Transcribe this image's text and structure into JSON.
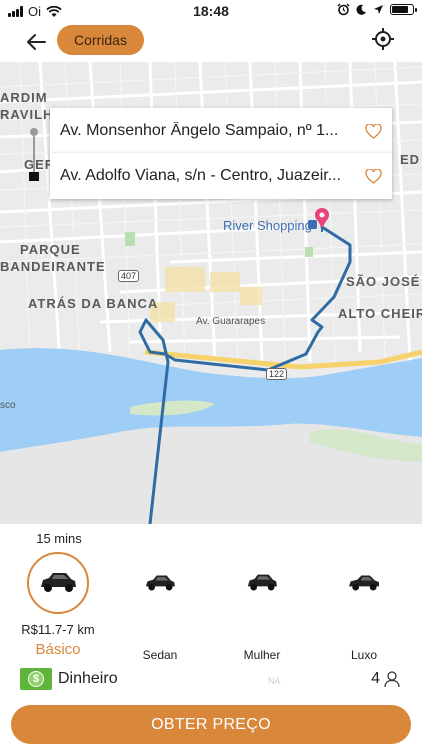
{
  "status_bar": {
    "carrier": "Oi",
    "time": "18:48"
  },
  "header": {
    "rides_button_label": "Corridas"
  },
  "map": {
    "labels": {
      "jardim": "ARDIM",
      "gravilha": "RAVILHA",
      "parque": "PARQUE",
      "bandeirante": "BANDEIRANTE",
      "atras_da_banca": "ATRÁS DA BANCA",
      "sao_jose": "SÃO JOSÉ",
      "alto_cheiro": "ALTO CHEIRO",
      "guararapes": "Av. Guararapes",
      "ed": "ED",
      "ger": "GER",
      "river_shopping": "River Shopping",
      "sco": "sco",
      "route_407": "407",
      "route_122": "122"
    },
    "colors": {
      "route": "#2f6ca3",
      "water": "#9ecdf5",
      "pin": "#e9437a"
    }
  },
  "addresses": {
    "origin": "Av. Monsenhor Ângelo Sampaio, nº 1...",
    "destination": "Av. Adolfo Viana, s/n - Centro, Juazeir..."
  },
  "sheet": {
    "eta": "15 mins",
    "vehicles": [
      {
        "name": "Básico",
        "price": "R$11.7-7 km",
        "selected": true
      },
      {
        "name": "Sedan"
      },
      {
        "name": "Mulher"
      },
      {
        "name": "Luxo"
      }
    ],
    "payment_method": "Dinheiro",
    "payment_icon_symbol": "$",
    "na_label": "NA",
    "seats": "4",
    "cta_label": "OBTER PREÇO"
  },
  "colors": {
    "accent": "#d9873a",
    "cash_green": "#5fb53a"
  }
}
